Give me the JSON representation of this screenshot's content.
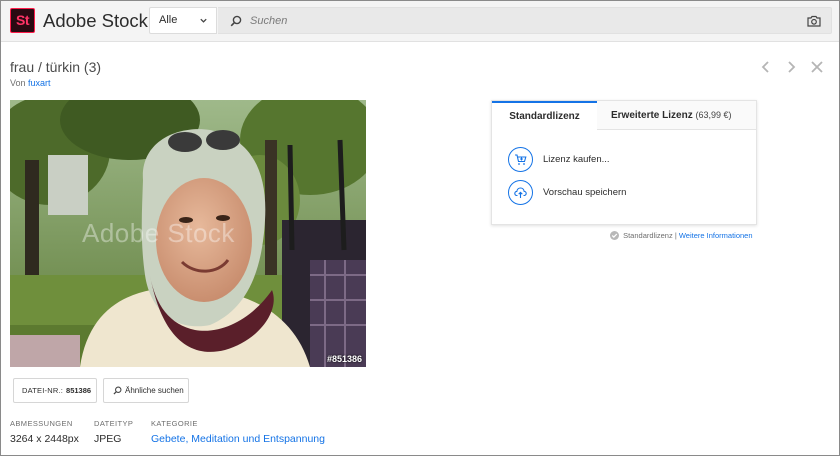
{
  "header": {
    "logo_text": "St",
    "brand": "Adobe Stock",
    "filter_value": "Alle",
    "search_placeholder": "Suchen"
  },
  "asset": {
    "title": "frau / türkin (3)",
    "by_label": "Von",
    "author": "fuxart",
    "watermark": "Adobe Stock",
    "image_id_overlay": "#851386",
    "file_no_label": "DATEI-NR.:",
    "file_no_value": "851386",
    "similar_label": "Ähnliche suchen"
  },
  "meta": {
    "dimensions_label": "ABMESSUNGEN",
    "dimensions_value": "3264 x 2448px",
    "filetype_label": "DATEITYP",
    "filetype_value": "JPEG",
    "category_label": "KATEGORIE",
    "category_value": "Gebete, Meditation und Entspannung"
  },
  "license": {
    "tab_standard": "Standardlizenz",
    "tab_extended": "Erweiterte Lizenz",
    "tab_extended_price": "(63,99 €)",
    "buy_label": "Lizenz kaufen...",
    "save_preview_label": "Vorschau speichern",
    "note_prefix": "Standardlizenz",
    "note_separator": "|",
    "note_link": "Weitere Informationen"
  },
  "colors": {
    "accent": "#1473e6",
    "logo_bg": "#2a0a12",
    "logo_fg": "#ff3366"
  },
  "icons": [
    "chevron-down-icon",
    "search-icon",
    "camera-icon",
    "chevron-left-icon",
    "chevron-right-icon",
    "close-icon",
    "cart-icon",
    "cloud-upload-icon",
    "check-icon"
  ]
}
